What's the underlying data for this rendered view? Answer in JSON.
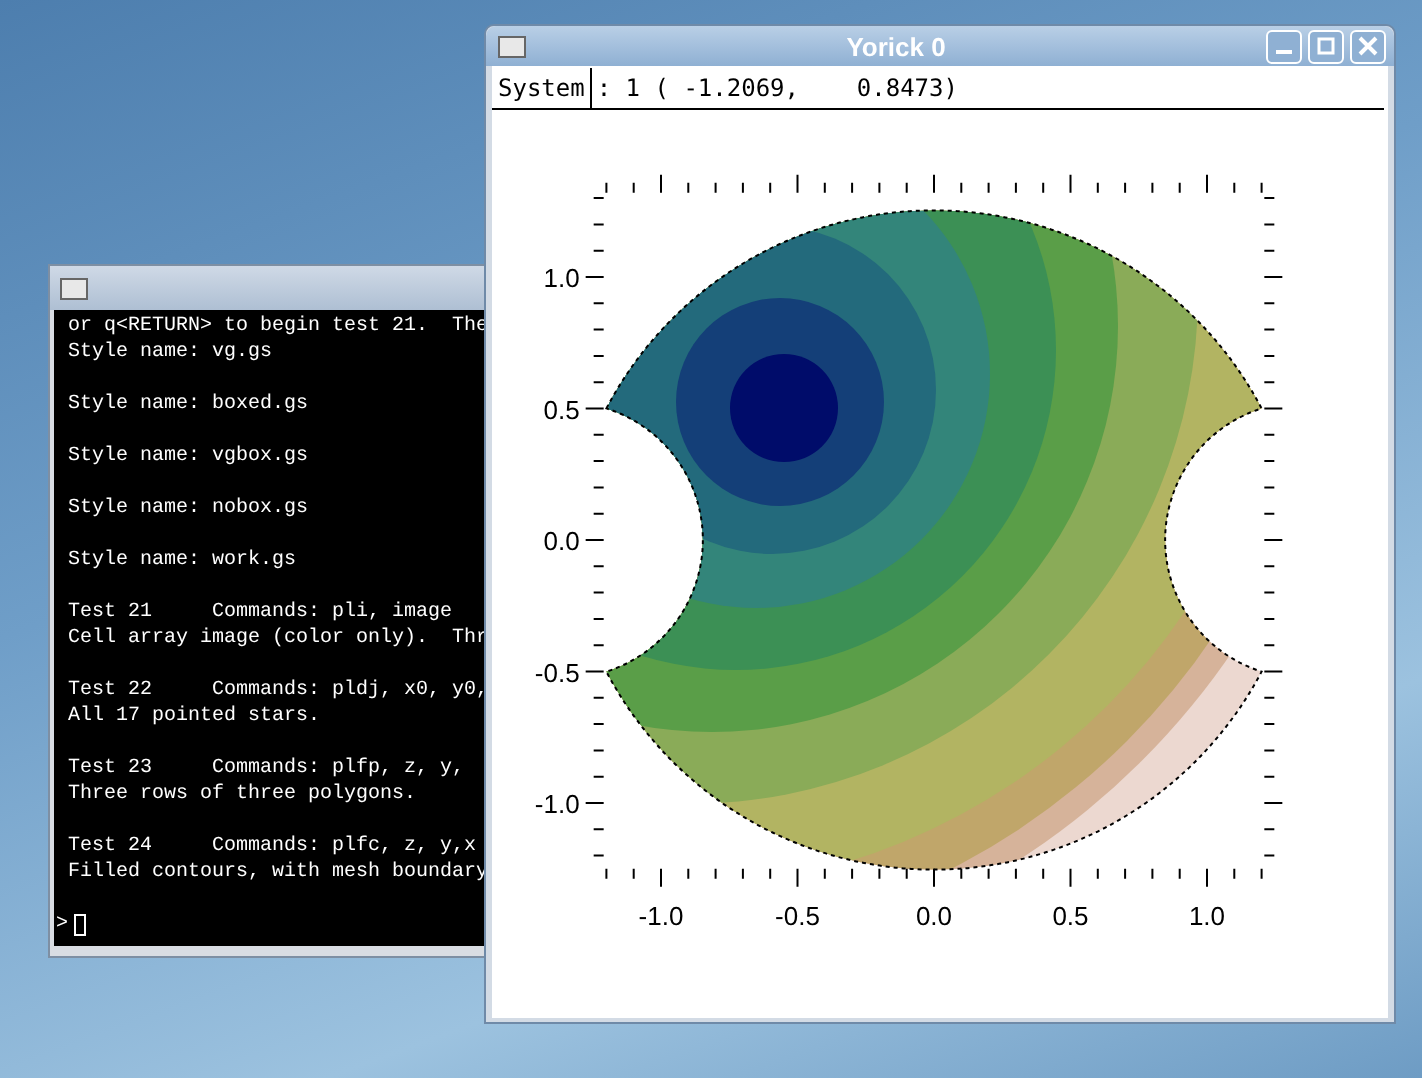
{
  "terminal": {
    "blocks": [
      [
        "or q<RETURN> to begin test 21.  The",
        "Style name: vg.gs"
      ],
      [
        "Style name: boxed.gs"
      ],
      [
        "Style name: vgbox.gs"
      ],
      [
        "Style name: nobox.gs"
      ],
      [
        "Style name: work.gs"
      ],
      [
        "Test 21     Commands: pli, image",
        "Cell array image (color only).  Thr"
      ],
      [
        "Test 22     Commands: pldj, x0, y0,",
        "All 17 pointed stars."
      ],
      [
        "Test 23     Commands: plfp, z, y,",
        "Three rows of three polygons."
      ],
      [
        "Test 24     Commands: plfc, z, y,x",
        "Filled contours, with mesh boundary"
      ]
    ],
    "prompt": ">"
  },
  "plot_window": {
    "title": "Yorick 0",
    "system_button": "System",
    "coordinates": ": 1 ( -1.2069,    0.8473)",
    "x_tick_labels": [
      "-1.0",
      "-0.5",
      "0.0",
      "0.5",
      "1.0"
    ],
    "y_tick_labels": [
      "1.0",
      "0.5",
      "0.0",
      "-0.5",
      "-1.0"
    ]
  }
}
